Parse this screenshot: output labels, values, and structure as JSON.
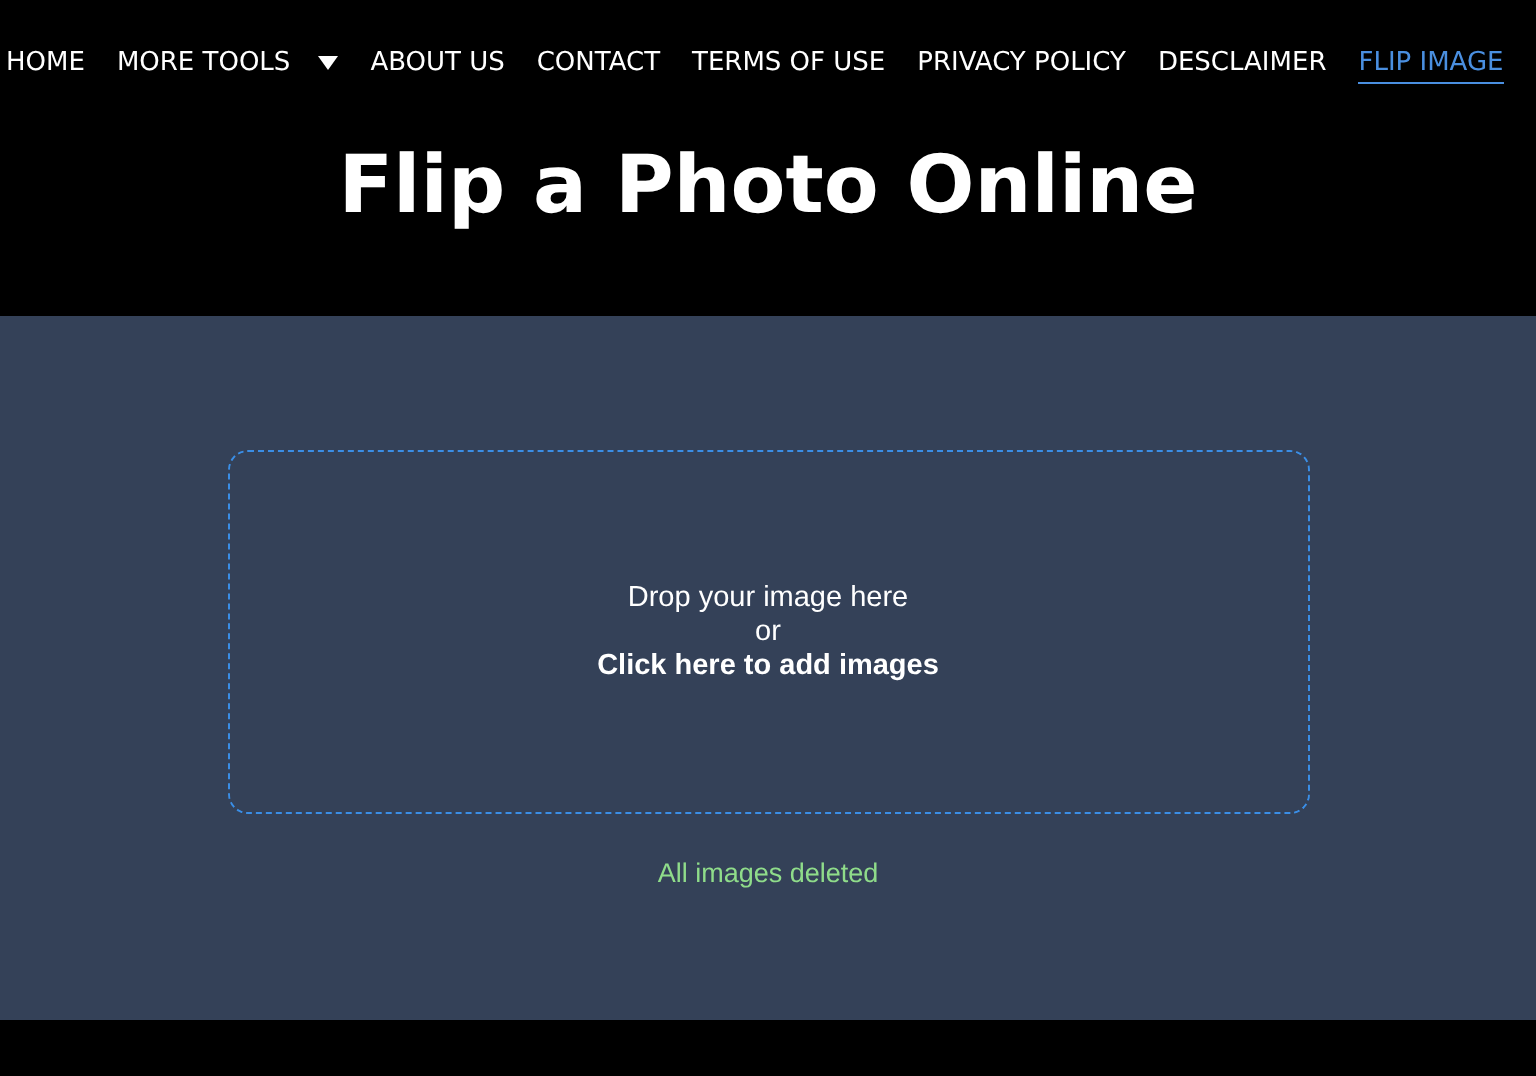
{
  "nav": {
    "items": [
      {
        "label": "HOME",
        "kind": "link",
        "selected": false
      },
      {
        "label": "MORE TOOLS",
        "kind": "dropdown",
        "selected": false
      },
      {
        "label": "ABOUT US",
        "kind": "link",
        "selected": false
      },
      {
        "label": "CONTACT",
        "kind": "link",
        "selected": false
      },
      {
        "label": "TERMS OF USE",
        "kind": "link",
        "selected": false
      },
      {
        "label": "PRIVACY POLICY",
        "kind": "link",
        "selected": false
      },
      {
        "label": "DESCLAIMER",
        "kind": "link",
        "selected": false
      },
      {
        "label": "FLIP IMAGE",
        "kind": "link",
        "selected": true
      }
    ]
  },
  "title": "Flip a Photo Online",
  "dropzone": {
    "line_1": "Drop your image here",
    "line_2": "or",
    "action": "Click here to add images"
  },
  "status": "All images deleted"
}
